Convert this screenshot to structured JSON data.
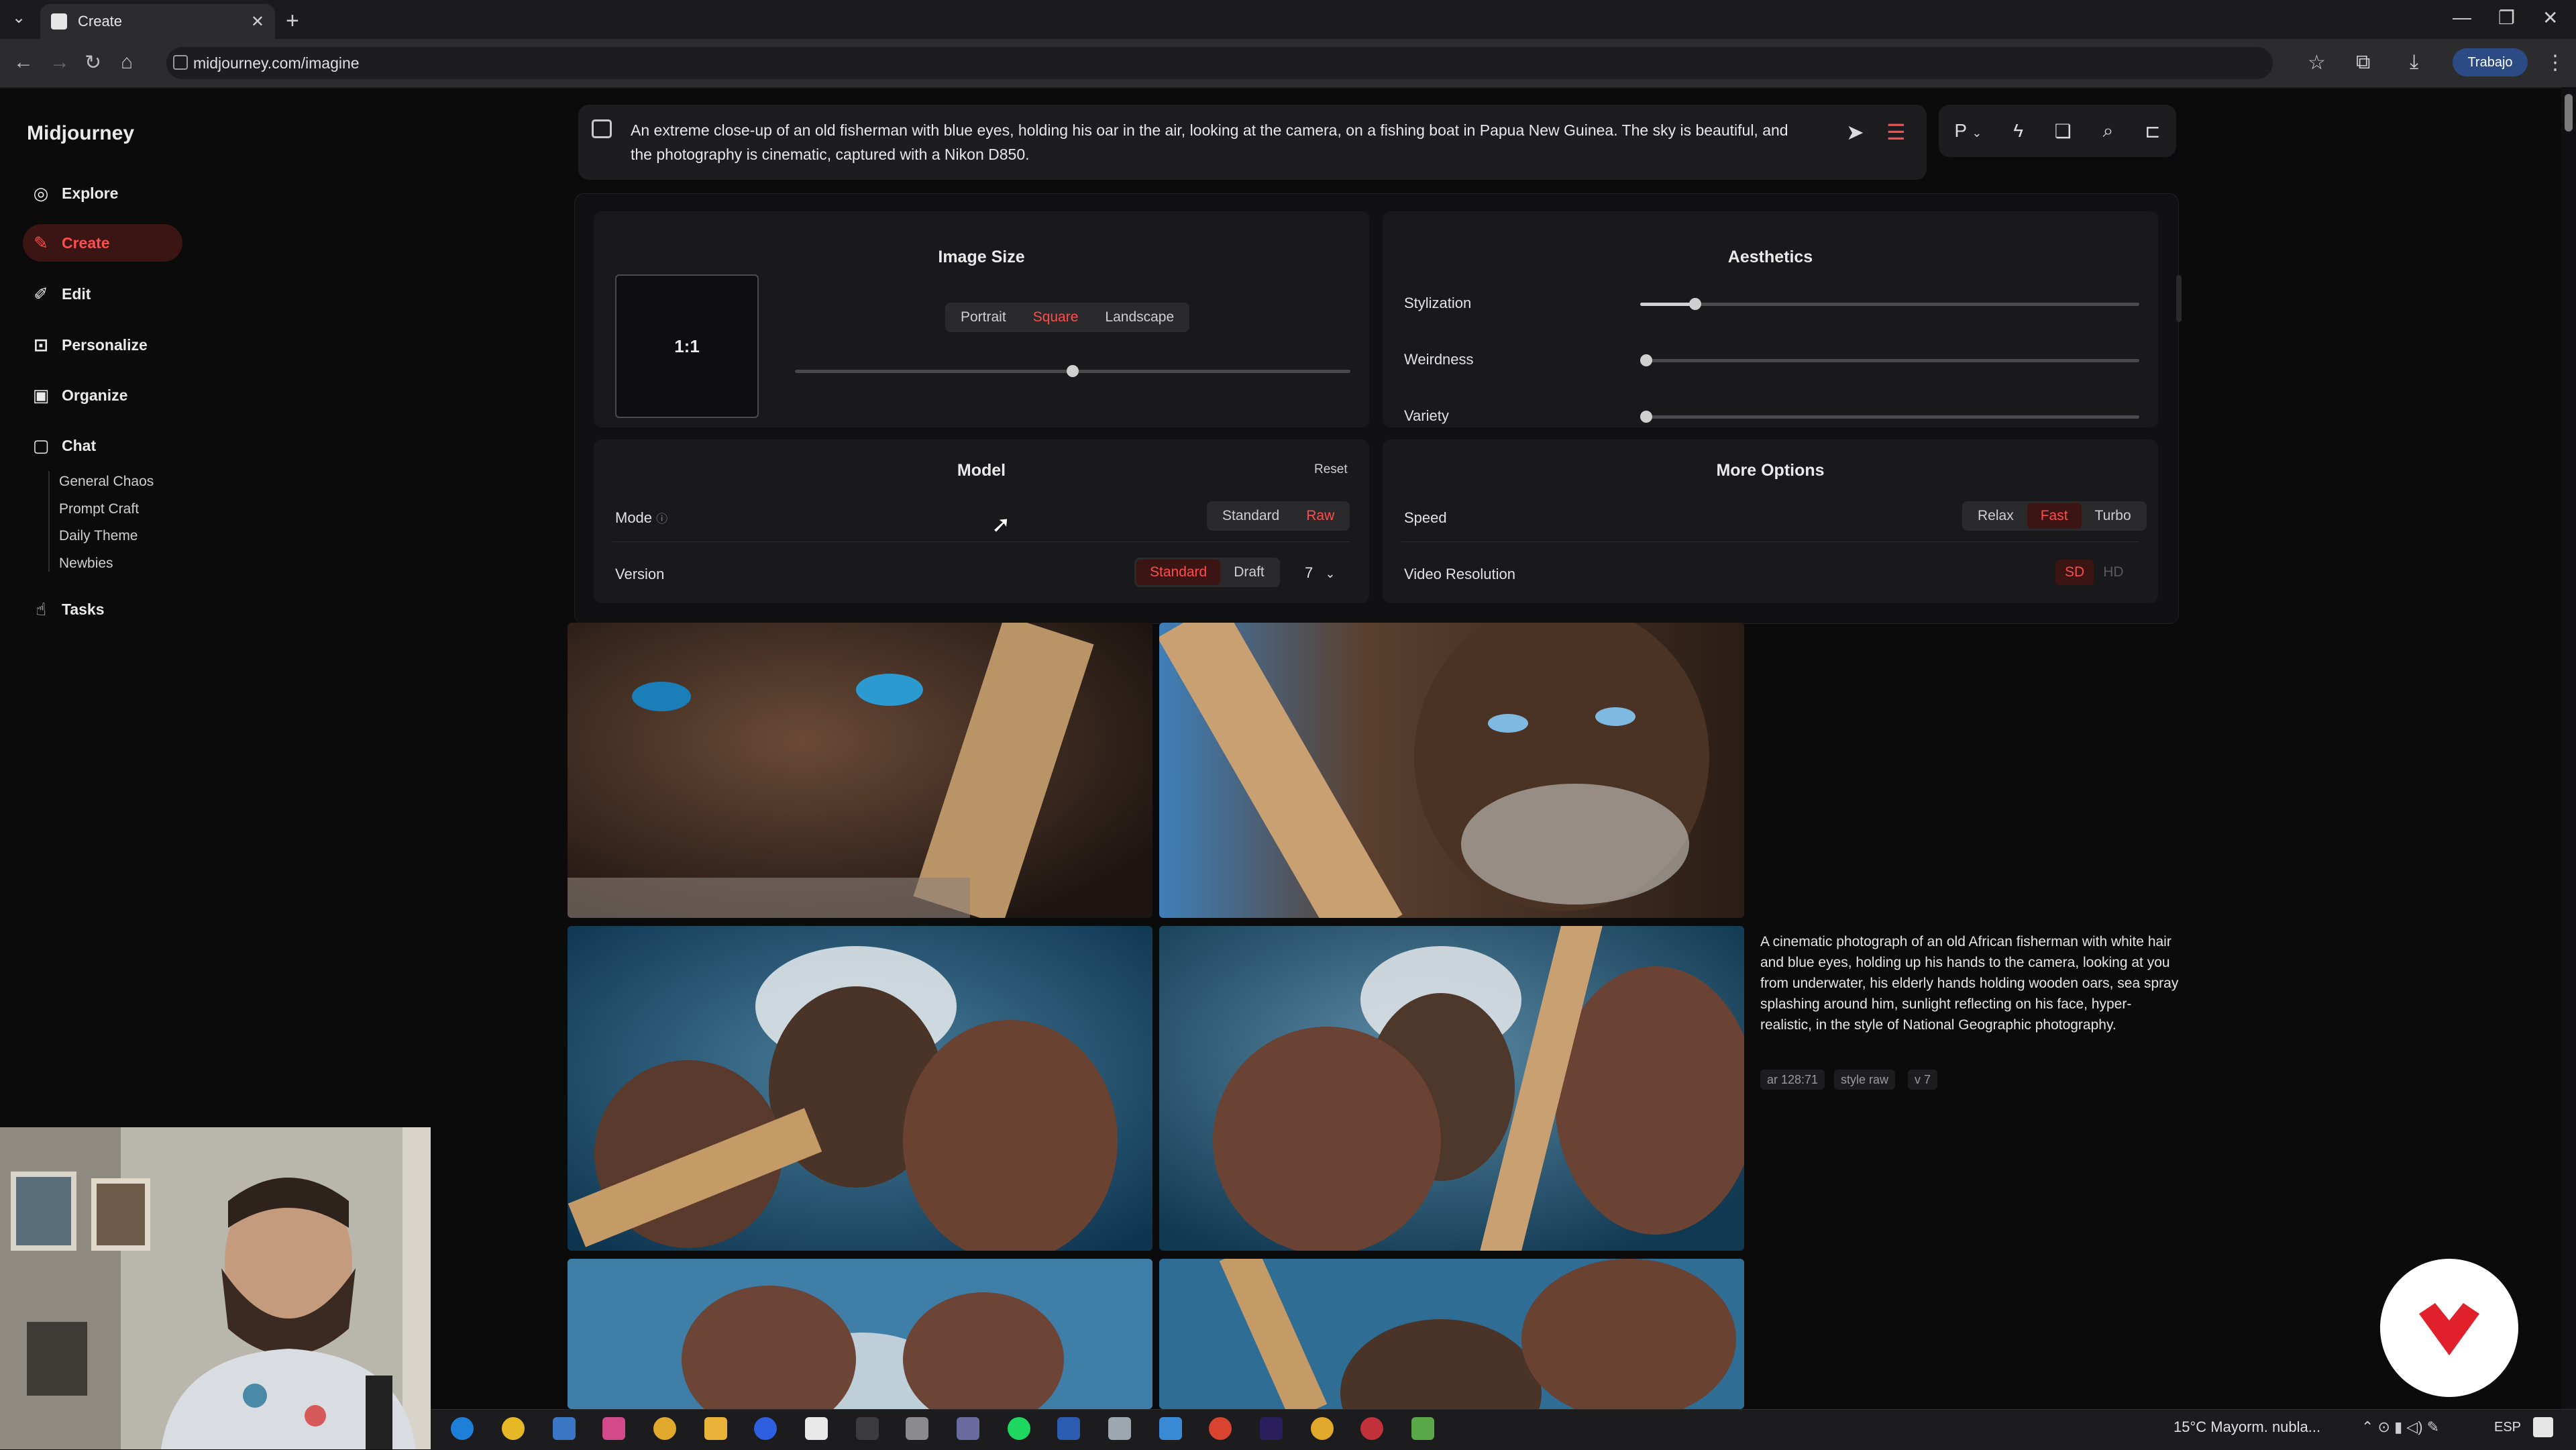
{
  "browser": {
    "tab_title": "Create",
    "url": "midjourney.com/imagine",
    "profile_label": "Trabajo"
  },
  "sidebar": {
    "logo": "Midjourney",
    "items": [
      {
        "label": "Explore"
      },
      {
        "label": "Create"
      },
      {
        "label": "Edit"
      },
      {
        "label": "Personalize"
      },
      {
        "label": "Organize"
      },
      {
        "label": "Chat"
      },
      {
        "label": "Tasks"
      }
    ],
    "chat_channels": [
      "General Chaos",
      "Prompt Craft",
      "Daily Theme",
      "Newbies"
    ]
  },
  "prompt": {
    "text": "An extreme close-up of an old fisherman with blue eyes, holding his oar in the air, looking at the camera, on a fishing boat in Papua New Guinea. The sky is beautiful, and the photography is cinematic, captured with a Nikon D850."
  },
  "tools": {
    "personalize_label": "P"
  },
  "image_size": {
    "title": "Image Size",
    "ratio": "1:1",
    "orientations": [
      "Portrait",
      "Square",
      "Landscape"
    ],
    "selected": "Square",
    "slider_fraction": 0.5
  },
  "aesthetics": {
    "title": "Aesthetics",
    "stylization": {
      "label": "Stylization",
      "fraction": 0.1
    },
    "weirdness": {
      "label": "Weirdness",
      "fraction": 0.0
    },
    "variety": {
      "label": "Variety",
      "fraction": 0.0
    }
  },
  "model": {
    "title": "Model",
    "reset_label": "Reset",
    "mode_label": "Mode",
    "mode_options": [
      "Standard",
      "Raw"
    ],
    "mode_selected": "Raw",
    "version_label": "Version",
    "version_options": [
      "Standard",
      "Draft"
    ],
    "version_selected": "Standard",
    "version_number": "7"
  },
  "more_options": {
    "title": "More Options",
    "speed_label": "Speed",
    "speed_options": [
      "Relax",
      "Fast",
      "Turbo"
    ],
    "speed_selected": "Fast",
    "video_label": "Video Resolution",
    "video_options": [
      "SD",
      "HD"
    ],
    "video_selected": "SD"
  },
  "feed": {
    "caption": "A cinematic photograph of an old African fisherman with white hair and blue eyes, holding up his hands to the camera, looking at you from underwater, his elderly hands holding wooden oars, sea spray splashing around him, sunlight reflecting on his face, hyper-realistic, in the style of National Geographic photography.",
    "tags": [
      "ar 128:71",
      "style raw",
      "v 7"
    ]
  },
  "system": {
    "weather": "15°C  Mayorm. nubla...",
    "lang": "ESP"
  },
  "colors": {
    "accent": "#ff4d4d",
    "accent_bg": "#3b1414",
    "panel_bg": "#19191b",
    "page_bg": "#0b0b0c"
  }
}
